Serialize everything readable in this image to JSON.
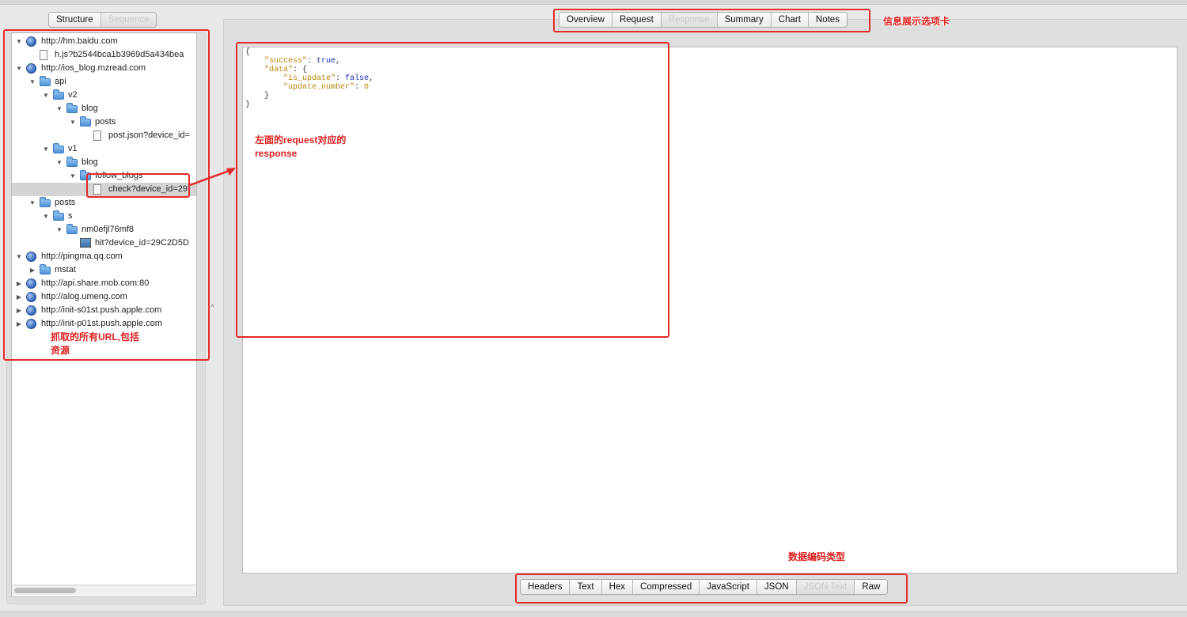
{
  "left_tabs": [
    {
      "label": "Structure",
      "active": false
    },
    {
      "label": "Sequence",
      "active": true
    }
  ],
  "tree": [
    {
      "label": "http://hm.baidu.com",
      "icon": "globe-icon",
      "expanded": true,
      "depth": 0
    },
    {
      "label": "h.js?b2544bca1b3969d5a434bea",
      "icon": "script-file-icon",
      "depth": 1,
      "leaf": true
    },
    {
      "label": "http://ios_blog.mzread.com",
      "icon": "globe-icon",
      "expanded": true,
      "depth": 0
    },
    {
      "label": "api",
      "icon": "folder-icon",
      "expanded": true,
      "depth": 1
    },
    {
      "label": "v2",
      "icon": "folder-icon",
      "expanded": true,
      "depth": 2
    },
    {
      "label": "blog",
      "icon": "folder-icon",
      "expanded": true,
      "depth": 3
    },
    {
      "label": "posts",
      "icon": "folder-icon",
      "expanded": true,
      "depth": 4
    },
    {
      "label": "post.json?device_id=",
      "icon": "document-icon",
      "depth": 5,
      "leaf": true
    },
    {
      "label": "v1",
      "icon": "folder-icon",
      "expanded": true,
      "depth": 2
    },
    {
      "label": "blog",
      "icon": "folder-icon",
      "expanded": true,
      "depth": 3
    },
    {
      "label": "follow_blogs",
      "icon": "folder-icon",
      "expanded": true,
      "depth": 4
    },
    {
      "label": "check?device_id=29",
      "icon": "document-icon",
      "depth": 5,
      "leaf": true,
      "selected": true
    },
    {
      "label": "posts",
      "icon": "folder-icon",
      "expanded": true,
      "depth": 1
    },
    {
      "label": "s",
      "icon": "folder-icon",
      "expanded": true,
      "depth": 2
    },
    {
      "label": "nm0efjl76mf8",
      "icon": "folder-icon",
      "expanded": true,
      "depth": 3
    },
    {
      "label": "hit?device_id=29C2D5D",
      "icon": "image-file-icon",
      "depth": 4,
      "leaf": true
    },
    {
      "label": "http://pingma.qq.com",
      "icon": "globe-icon",
      "expanded": true,
      "depth": 0
    },
    {
      "label": "mstat",
      "icon": "folder-icon",
      "expanded": false,
      "depth": 1
    },
    {
      "label": "http://api.share.mob.com:80",
      "icon": "globe-icon",
      "expanded": false,
      "depth": 0
    },
    {
      "label": "http://alog.umeng.com",
      "icon": "globe-icon",
      "expanded": false,
      "depth": 0
    },
    {
      "label": "http://init-s01st.push.apple.com",
      "icon": "globe-icon",
      "expanded": false,
      "depth": 0
    },
    {
      "label": "http://init-p01st.push.apple.com",
      "icon": "globe-icon",
      "expanded": false,
      "depth": 0
    }
  ],
  "info_tabs": [
    {
      "label": "Overview",
      "active": false
    },
    {
      "label": "Request",
      "active": false
    },
    {
      "label": "Response",
      "active": true
    },
    {
      "label": "Summary",
      "active": false
    },
    {
      "label": "Chart",
      "active": false
    },
    {
      "label": "Notes",
      "active": false
    }
  ],
  "format_tabs": [
    {
      "label": "Headers",
      "active": false
    },
    {
      "label": "Text",
      "active": false
    },
    {
      "label": "Hex",
      "active": false
    },
    {
      "label": "Compressed",
      "active": false
    },
    {
      "label": "JavaScript",
      "active": false
    },
    {
      "label": "JSON",
      "active": false
    },
    {
      "label": "JSON Text",
      "active": true
    },
    {
      "label": "Raw",
      "active": false
    }
  ],
  "response_lines": [
    [
      {
        "t": "{",
        "c": ""
      }
    ],
    [
      {
        "t": "    ",
        "c": ""
      },
      {
        "t": "\"success\"",
        "c": "k"
      },
      {
        "t": ": ",
        "c": ""
      },
      {
        "t": "true",
        "c": "b"
      },
      {
        "t": ",",
        "c": ""
      }
    ],
    [
      {
        "t": "    ",
        "c": ""
      },
      {
        "t": "\"data\"",
        "c": "k"
      },
      {
        "t": ": {",
        "c": ""
      }
    ],
    [
      {
        "t": "        ",
        "c": ""
      },
      {
        "t": "\"is_update\"",
        "c": "k"
      },
      {
        "t": ": ",
        "c": ""
      },
      {
        "t": "false",
        "c": "b"
      },
      {
        "t": ",",
        "c": ""
      }
    ],
    [
      {
        "t": "        ",
        "c": ""
      },
      {
        "t": "\"update_number\"",
        "c": "k"
      },
      {
        "t": ": ",
        "c": ""
      },
      {
        "t": "0",
        "c": "n"
      }
    ],
    [
      {
        "t": "    }",
        "c": ""
      }
    ],
    [
      {
        "t": "}",
        "c": ""
      }
    ]
  ],
  "annotations": {
    "info_tabs": "信息展示选项卡",
    "response_line1": "左面的request对应的",
    "response_line2": "response",
    "urls_line1": "抓取的所有URL,包括",
    "urls_line2": "资源",
    "format_tabs": "数据编码类型"
  },
  "colors": {
    "annotation": "#e52a2a",
    "json_key": "#b8860b",
    "json_bool": "#1a2fb0"
  }
}
